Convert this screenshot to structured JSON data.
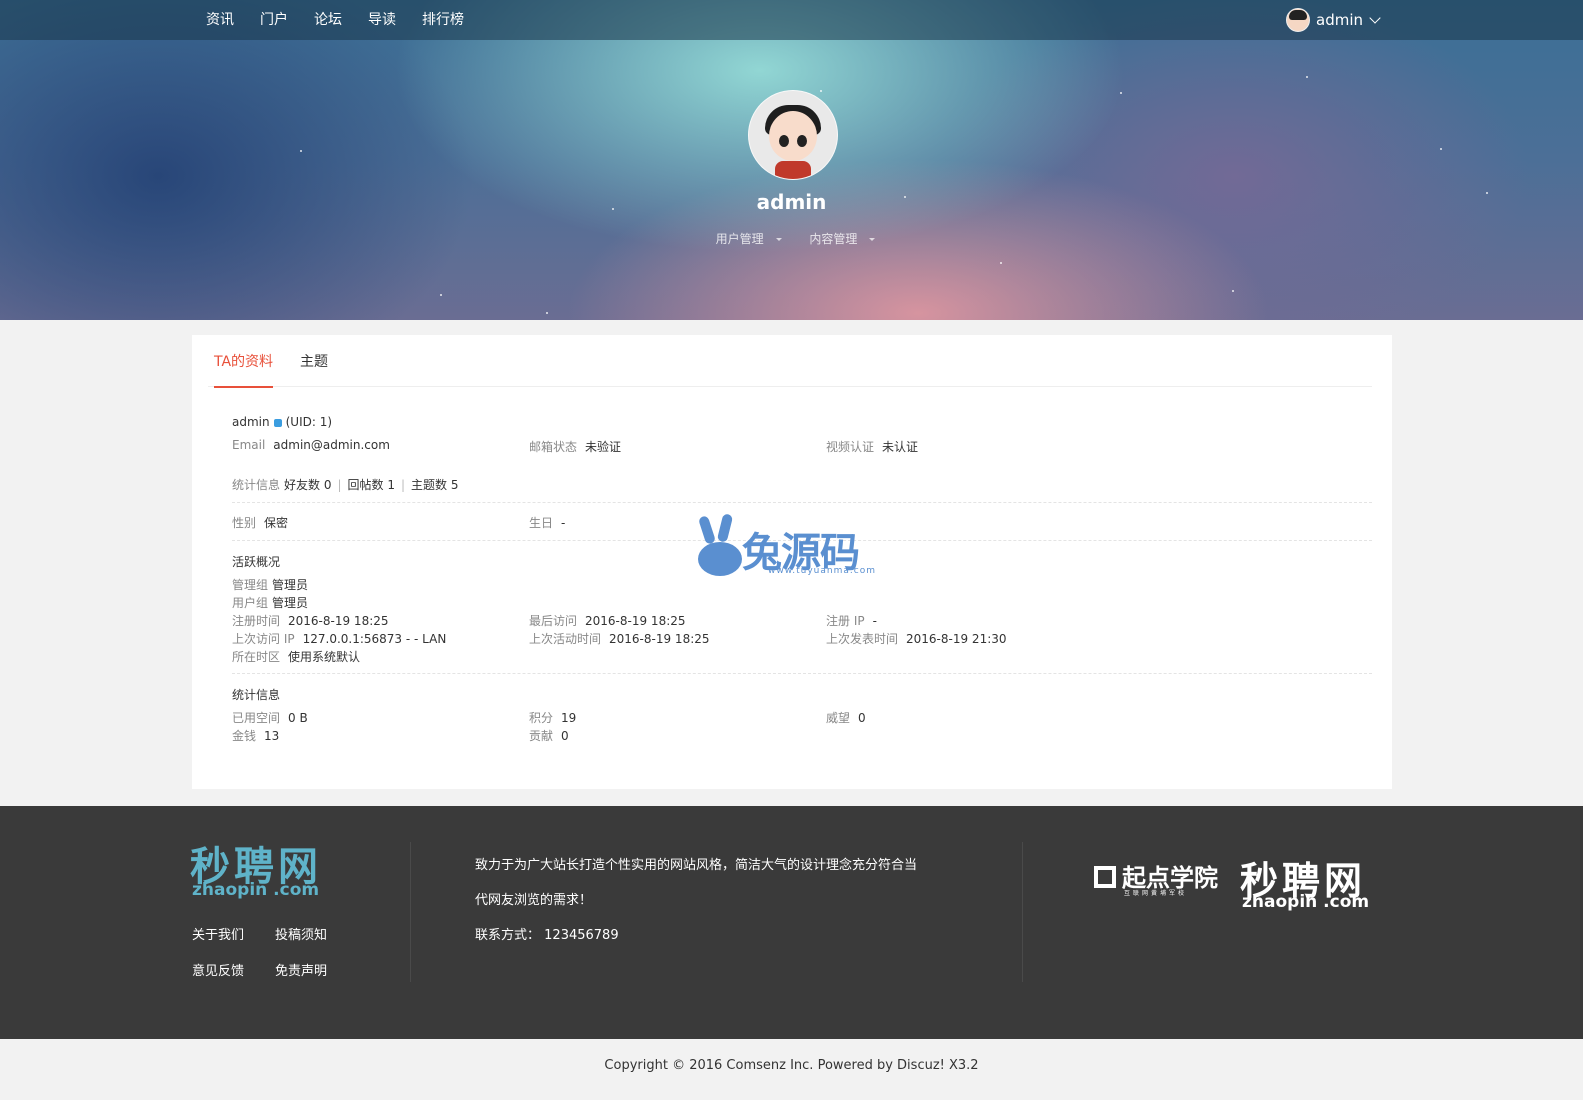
{
  "nav": {
    "links": [
      "资讯",
      "门户",
      "论坛",
      "导读",
      "排行榜"
    ],
    "username": "admin"
  },
  "profile": {
    "name": "admin",
    "menus": [
      "用户管理",
      "内容管理"
    ]
  },
  "tabs": [
    "TA的资料",
    "主题"
  ],
  "info": {
    "username": "admin",
    "uid": "(UID: 1)",
    "email_label": "Email",
    "email": "admin@admin.com",
    "mail_status_label": "邮箱状态",
    "mail_status": "未验证",
    "video_label": "视频认证",
    "video_status": "未认证",
    "stats_label": "统计信息",
    "friends": "好友数 0",
    "replies": "回帖数 1",
    "topics": "主题数 5",
    "gender_label": "性别",
    "gender": "保密",
    "birthday_label": "生日",
    "birthday": "-"
  },
  "activity": {
    "title": "活跃概况",
    "admin_group_label": "管理组",
    "admin_group": "管理员",
    "user_group_label": "用户组",
    "user_group": "管理员",
    "reg_time_label": "注册时间",
    "reg_time": "2016-8-19 18:25",
    "last_visit_label": "最后访问",
    "last_visit": "2016-8-19 18:25",
    "reg_ip_label": "注册 IP",
    "reg_ip": "-",
    "last_ip_label": "上次访问 IP",
    "last_ip": "127.0.0.1:56873 - - LAN",
    "last_active_label": "上次活动时间",
    "last_active": "2016-8-19 18:25",
    "last_post_label": "上次发表时间",
    "last_post": "2016-8-19 21:30",
    "timezone_label": "所在时区",
    "timezone": "使用系统默认"
  },
  "stats": {
    "title": "统计信息",
    "space_label": "已用空间",
    "space": "0 B",
    "points_label": "积分",
    "points": "19",
    "prestige_label": "威望",
    "prestige": "0",
    "money_label": "金钱",
    "money": "13",
    "contrib_label": "贡献",
    "contrib": "0"
  },
  "watermark": {
    "text": "兔源码",
    "url": "www.tuyuanma.com"
  },
  "footer": {
    "logo_cn": "秒聘网",
    "logo_en": "zhaopin",
    "logo_dot": ".com",
    "links": [
      "关于我们",
      "投稿须知",
      "意见反馈",
      "免责声明"
    ],
    "slogan_1": "致力于为广大站长打造个性实用的网站风格，简洁大气的设计理念充分符合当",
    "slogan_2": "代网友浏览的需求！",
    "contact_label": "联系方式：",
    "contact": "123456789",
    "qidian": "起点学院",
    "qidian_sub": "互联网黄埔军校"
  },
  "copyright": "Copyright © 2016 Comsenz Inc. Powered by Discuz! X3.2"
}
